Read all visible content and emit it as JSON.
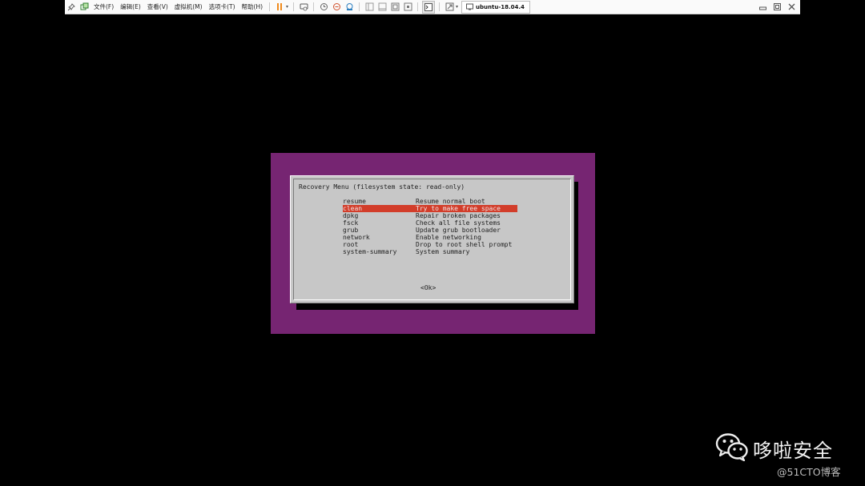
{
  "toolbar": {
    "menus": [
      "文件(F)",
      "编辑(E)",
      "查看(V)",
      "虚拟机(M)",
      "选项卡(T)",
      "帮助(H)"
    ],
    "tab_label": "ubuntu-18.04.4"
  },
  "recovery_menu": {
    "title": "Recovery Menu (filesystem state: read-only)",
    "items": [
      {
        "key": "resume",
        "desc": "Resume normal boot"
      },
      {
        "key": "clean",
        "desc": "Try to make free space"
      },
      {
        "key": "dpkg",
        "desc": "Repair broken packages"
      },
      {
        "key": "fsck",
        "desc": "Check all file systems"
      },
      {
        "key": "grub",
        "desc": "Update grub bootloader"
      },
      {
        "key": "network",
        "desc": "Enable networking"
      },
      {
        "key": "root",
        "desc": "Drop to root shell prompt"
      },
      {
        "key": "system-summary",
        "desc": "System summary"
      }
    ],
    "selected_index": 1,
    "ok_label": "<Ok>"
  },
  "colors": {
    "purple": "#762572",
    "dialog_gray": "#c7c7c7",
    "highlight": "#d23d2a",
    "pause_orange": "#f08a1c"
  },
  "icons": {
    "toolbar": [
      "pin-icon",
      "library-icon",
      "pause-icon",
      "send-keys-icon",
      "snapshot-icon",
      "revert-snapshot-icon",
      "snapshot-manager-icon",
      "view-sidebar-icon",
      "view-single-icon",
      "fullscreen-icon",
      "unity-icon",
      "console-icon",
      "stretch-icon",
      "vm-tab-icon",
      "minimize-icon",
      "restore-icon",
      "close-icon"
    ],
    "watermark": "wechat-icon"
  },
  "watermark": {
    "title": "哆啦安全",
    "site": "@51CTO博客"
  }
}
